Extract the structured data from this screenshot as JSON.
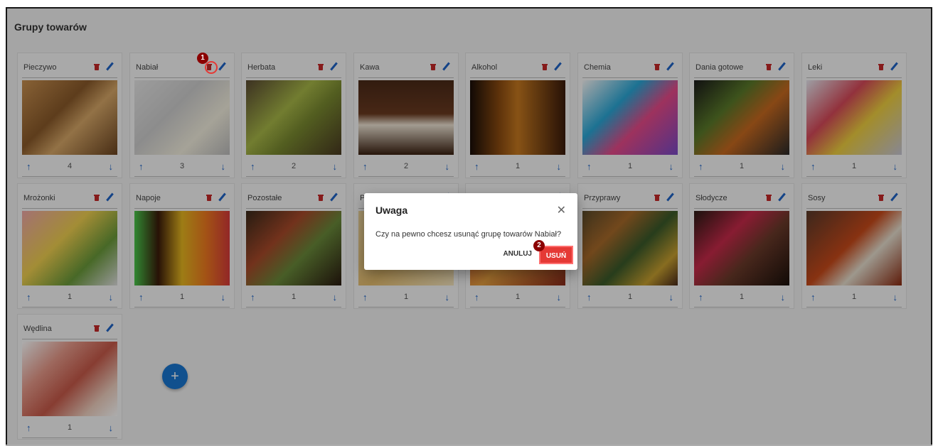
{
  "page": {
    "title": "Grupy towarów"
  },
  "groups": [
    {
      "name": "Pieczywo",
      "order": "4"
    },
    {
      "name": "Nabiał",
      "order": "3"
    },
    {
      "name": "Herbata",
      "order": "2"
    },
    {
      "name": "Kawa",
      "order": "2"
    },
    {
      "name": "Alkohol",
      "order": "1"
    },
    {
      "name": "Chemia",
      "order": "1"
    },
    {
      "name": "Dania gotowe",
      "order": "1"
    },
    {
      "name": "Leki",
      "order": "1"
    },
    {
      "name": "Mrożonki",
      "order": "1"
    },
    {
      "name": "Napoje",
      "order": "1"
    },
    {
      "name": "Pozostałe",
      "order": "1"
    },
    {
      "name": "P",
      "order": "1"
    },
    {
      "name": "",
      "order": "1"
    },
    {
      "name": "Przyprawy",
      "order": "1"
    },
    {
      "name": "Słodycze",
      "order": "1"
    },
    {
      "name": "Sosy",
      "order": "1"
    },
    {
      "name": "Wędlina",
      "order": "1"
    }
  ],
  "icons": {
    "arrow_up": "↑",
    "arrow_down": "↓",
    "add": "+",
    "close": "✕"
  },
  "dialog": {
    "title": "Uwaga",
    "message": "Czy na pewno chcesz usunąć grupę towarów Nabiał?",
    "cancel_label": "ANULUJ",
    "confirm_label": "USUŃ"
  },
  "steps": [
    "1",
    "2"
  ],
  "colors": {
    "delete": "#c62828",
    "edit": "#1e64c8",
    "fab": "#1976d2",
    "confirm": "#e53935",
    "badge": "#8b0000"
  }
}
